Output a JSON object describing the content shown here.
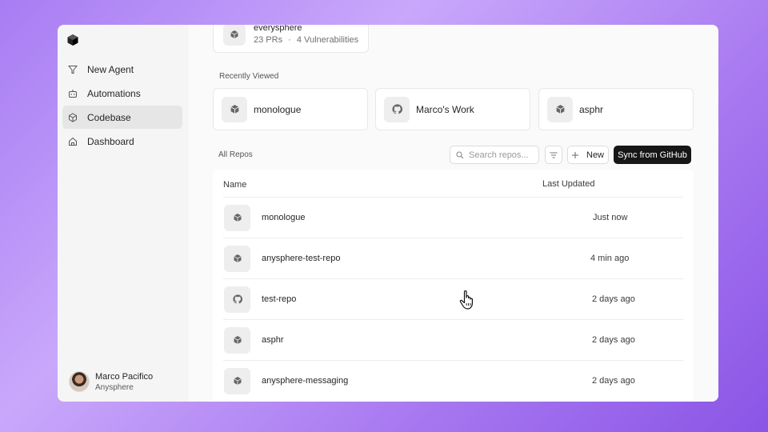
{
  "sidebar": {
    "items": [
      {
        "label": "New Agent",
        "icon": "agent-icon",
        "active": false
      },
      {
        "label": "Automations",
        "icon": "robot-icon",
        "active": false
      },
      {
        "label": "Codebase",
        "icon": "cube-icon",
        "active": true
      },
      {
        "label": "Dashboard",
        "icon": "home-icon",
        "active": false
      }
    ],
    "user": {
      "name": "Marco Pacifico",
      "org": "Anysphere"
    }
  },
  "top_card": {
    "title": "everysphere",
    "prs": "23 PRs",
    "separator": "·",
    "vulns": "4 Vulnerabilities"
  },
  "recently_viewed": {
    "label": "Recently Viewed",
    "items": [
      {
        "name": "monologue",
        "icon": "cube-icon"
      },
      {
        "name": "Marco's Work",
        "icon": "github-icon"
      },
      {
        "name": "asphr",
        "icon": "cube-icon"
      }
    ]
  },
  "repos": {
    "label": "All Repos",
    "search_placeholder": "Search repos...",
    "new_label": "New",
    "sync_label": "Sync from GitHub",
    "columns": {
      "name": "Name",
      "last_updated": "Last Updated"
    },
    "rows": [
      {
        "name": "monologue",
        "updated": "Just now",
        "icon": "cube-icon"
      },
      {
        "name": "anysphere-test-repo",
        "updated": "4 min ago",
        "icon": "cube-icon"
      },
      {
        "name": "test-repo",
        "updated": "2 days ago",
        "icon": "github-icon"
      },
      {
        "name": "asphr",
        "updated": "2 days ago",
        "icon": "cube-icon"
      },
      {
        "name": "anysphere-messaging",
        "updated": "2 days ago",
        "icon": "cube-icon"
      }
    ]
  },
  "colors": {
    "accent_bg": "#a87cf3",
    "primary_button": "#161616",
    "active_nav": "#e6e6e6"
  }
}
